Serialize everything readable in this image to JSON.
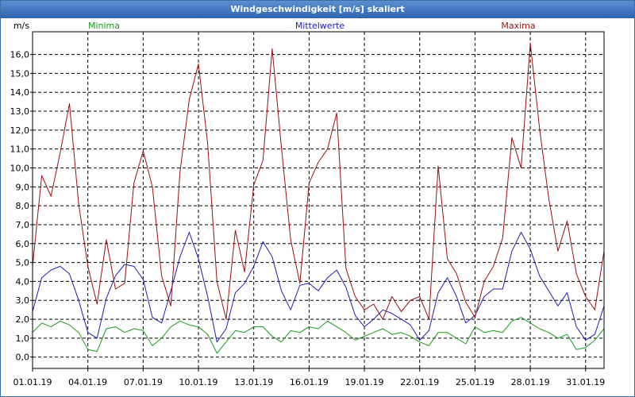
{
  "window": {
    "title": "Windgeschwindigkeit [m/s] skaliert"
  },
  "chart_data": {
    "type": "line",
    "title": "Windgeschwindigkeit [m/s] skaliert",
    "ylabel": "m/s",
    "xlabel": "",
    "ylim": [
      -0.6,
      17.2
    ],
    "yticks": [
      "0,0",
      "1,0",
      "2,0",
      "3,0",
      "4,0",
      "5,0",
      "6,0",
      "7,0",
      "8,0",
      "9,0",
      "10,0",
      "11,0",
      "12,0",
      "13,0",
      "14,0",
      "15,0",
      "16,0"
    ],
    "ytick_values": [
      0,
      1,
      2,
      3,
      4,
      5,
      6,
      7,
      8,
      9,
      10,
      11,
      12,
      13,
      14,
      15,
      16
    ],
    "xticks": [
      "01.01.19",
      "04.01.19",
      "07.01.19",
      "10.01.19",
      "13.01.19",
      "16.01.19",
      "19.01.19",
      "22.01.19",
      "25.01.19",
      "28.01.19",
      "31.01.19"
    ],
    "xtick_days": [
      0,
      3,
      6,
      9,
      12,
      15,
      18,
      21,
      24,
      27,
      30
    ],
    "xlim_days": [
      0,
      31
    ],
    "grid": true,
    "legend_placement": "top",
    "x_days": [
      0,
      0.5,
      1,
      1.5,
      2,
      2.5,
      3,
      3.5,
      4,
      4.5,
      5,
      5.5,
      6,
      6.5,
      7,
      7.5,
      8,
      8.5,
      9,
      9.5,
      10,
      10.5,
      11,
      11.5,
      12,
      12.5,
      13,
      13.5,
      14,
      14.5,
      15,
      15.5,
      16,
      16.5,
      17,
      17.5,
      18,
      18.5,
      19,
      19.5,
      20,
      20.5,
      21,
      21.5,
      22,
      22.5,
      23,
      23.5,
      24,
      24.5,
      25,
      25.5,
      26,
      26.5,
      27,
      27.5,
      28,
      28.5,
      29,
      29.5,
      30,
      30.5,
      31
    ],
    "series": [
      {
        "name": "Minima",
        "color": "#1a9a1a",
        "values": [
          1.3,
          1.8,
          1.6,
          1.9,
          1.7,
          1.3,
          0.4,
          0.3,
          1.5,
          1.6,
          1.3,
          1.5,
          1.4,
          0.6,
          1.0,
          1.6,
          1.9,
          1.7,
          1.6,
          1.2,
          0.2,
          0.8,
          1.4,
          1.3,
          1.6,
          1.6,
          1.1,
          0.8,
          1.4,
          1.3,
          1.6,
          1.5,
          1.9,
          1.6,
          1.3,
          0.9,
          1.1,
          1.3,
          1.5,
          1.2,
          1.3,
          1.1,
          0.8,
          0.6,
          1.3,
          1.3,
          1.0,
          0.7,
          1.6,
          1.3,
          1.4,
          1.3,
          1.9,
          2.1,
          1.8,
          1.5,
          1.3,
          1.0,
          1.2,
          0.4,
          0.5,
          0.9,
          1.5
        ]
      },
      {
        "name": "Mittelwerte",
        "color": "#1e1eb4",
        "values": [
          2.4,
          4.2,
          4.6,
          4.8,
          4.4,
          3.0,
          1.3,
          1.0,
          3.1,
          4.3,
          4.9,
          4.8,
          4.1,
          2.1,
          1.8,
          3.5,
          5.3,
          6.6,
          5.2,
          3.2,
          0.8,
          1.5,
          3.4,
          3.9,
          4.8,
          6.1,
          5.3,
          3.5,
          2.5,
          3.8,
          3.9,
          3.5,
          4.2,
          4.6,
          3.7,
          2.2,
          1.6,
          2.0,
          2.5,
          2.3,
          2.0,
          1.7,
          0.9,
          1.4,
          3.4,
          4.2,
          3.2,
          1.8,
          2.2,
          3.2,
          3.6,
          3.6,
          5.6,
          6.6,
          5.7,
          4.3,
          3.5,
          2.7,
          3.4,
          1.6,
          0.9,
          1.2,
          2.7
        ]
      },
      {
        "name": "Maxima",
        "color": "#9a1010",
        "values": [
          4.8,
          9.6,
          8.5,
          10.8,
          13.4,
          8.1,
          4.8,
          2.8,
          6.2,
          3.6,
          3.9,
          9.2,
          10.9,
          9.0,
          4.3,
          2.7,
          9.8,
          13.6,
          15.5,
          11.3,
          4.0,
          2.0,
          6.7,
          4.5,
          9.1,
          10.4,
          16.3,
          11.1,
          6.2,
          3.9,
          9.2,
          10.3,
          11.0,
          12.9,
          4.7,
          3.2,
          2.5,
          2.8,
          2.0,
          3.2,
          2.4,
          3.0,
          3.2,
          2.0,
          10.1,
          5.2,
          4.4,
          2.9,
          2.1,
          4.0,
          4.8,
          6.3,
          11.6,
          10.0,
          16.6,
          12.1,
          8.4,
          5.6,
          7.2,
          4.4,
          3.2,
          2.5,
          5.6
        ]
      }
    ]
  }
}
